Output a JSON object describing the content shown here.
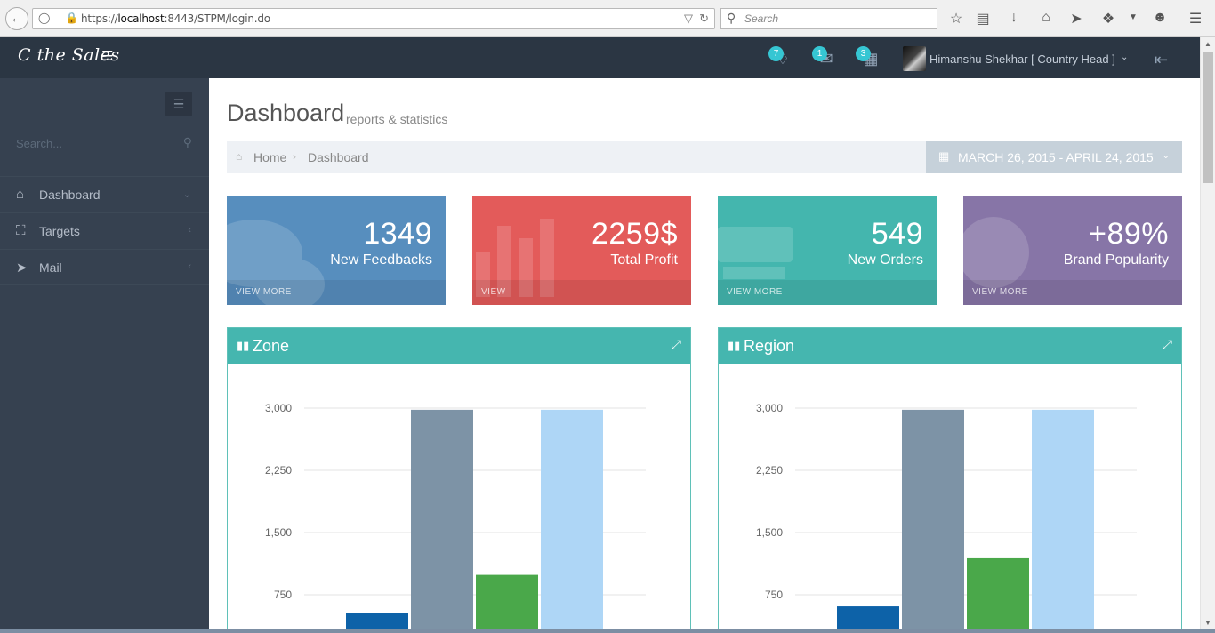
{
  "browser": {
    "back_icon": "back-arrow-icon",
    "url_prefix": "https://",
    "url_host": "localhost",
    "url_rest": ":8443/STPM/login.do",
    "search_placeholder": "Search"
  },
  "header": {
    "brand": "C the Sales",
    "notifications": [
      {
        "name": "bell-icon",
        "count": "7"
      },
      {
        "name": "envelope-icon",
        "count": "1"
      },
      {
        "name": "calendar-icon",
        "count": "3"
      }
    ],
    "user_name": "Himanshu Shekhar [ Country Head ]"
  },
  "sidebar": {
    "search_placeholder": "Search...",
    "items": [
      {
        "label": "Dashboard",
        "icon": "home-icon"
      },
      {
        "label": "Targets",
        "icon": "cart-icon"
      },
      {
        "label": "Mail",
        "icon": "rocket-icon"
      }
    ]
  },
  "page": {
    "title": "Dashboard",
    "subtitle": "reports & statistics",
    "breadcrumb_home": "Home",
    "breadcrumb_current": "Dashboard",
    "date_range": "MARCH 26, 2015 - APRIL 24, 2015"
  },
  "tiles": [
    {
      "number": "1349",
      "desc": "New Feedbacks",
      "more": "VIEW MORE",
      "color": "#578ebe"
    },
    {
      "number": "2259$",
      "desc": "Total Profit",
      "more": "VIEW",
      "color": "#e35b5a"
    },
    {
      "number": "549",
      "desc": "New Orders",
      "more": "VIEW MORE",
      "color": "#44b6ae"
    },
    {
      "number": "+89%",
      "desc": "Brand Popularity",
      "more": "VIEW MORE",
      "color": "#8775a7"
    }
  ],
  "portlets": [
    {
      "title": "Zone"
    },
    {
      "title": "Region"
    }
  ],
  "chart_data": [
    {
      "type": "bar",
      "title": "Zone",
      "ylim": [
        0,
        3000
      ],
      "yticks": [
        "3,000",
        "2,250",
        "1,500",
        "750"
      ],
      "series": [
        {
          "values": [
            530,
            2980,
            990,
            2980
          ]
        }
      ],
      "colors": [
        "#0d62a8",
        "#7d93a6",
        "#4aa84a",
        "#aed6f6"
      ],
      "grid": true
    },
    {
      "type": "bar",
      "title": "Region",
      "ylim": [
        0,
        3000
      ],
      "yticks": [
        "3,000",
        "2,250",
        "1,500",
        "750"
      ],
      "series": [
        {
          "values": [
            610,
            2980,
            1190,
            2980
          ]
        }
      ],
      "colors": [
        "#0d62a8",
        "#7d93a6",
        "#4aa84a",
        "#aed6f6"
      ],
      "grid": true
    }
  ]
}
